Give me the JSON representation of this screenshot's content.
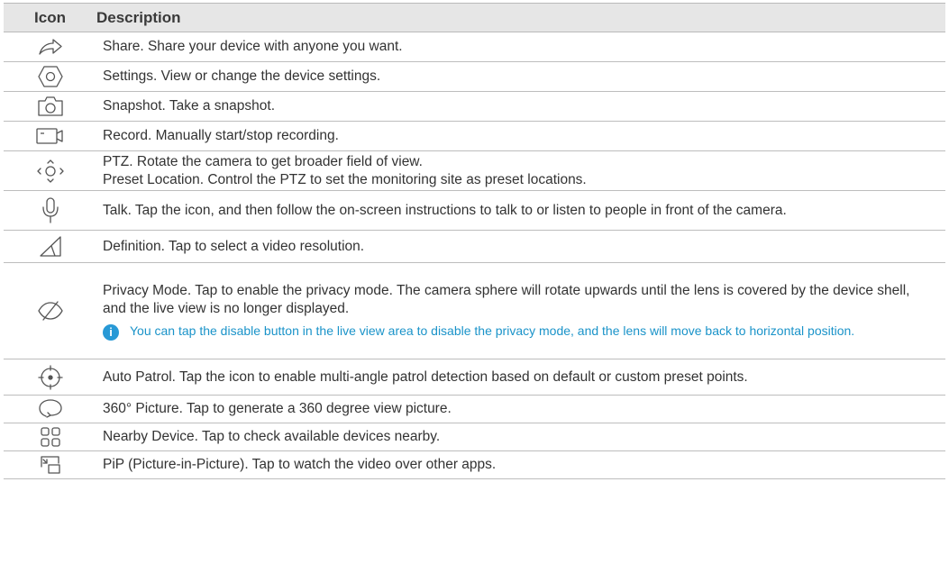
{
  "table": {
    "headers": {
      "icon": "Icon",
      "description": "Description"
    },
    "rows": [
      {
        "icon": "share-icon",
        "text": "Share. Share your device with anyone you want."
      },
      {
        "icon": "settings-icon",
        "text": "Settings. View or change the device settings."
      },
      {
        "icon": "camera-icon",
        "text": "Snapshot. Take a snapshot."
      },
      {
        "icon": "record-icon",
        "text": "Record. Manually start/stop recording."
      },
      {
        "icon": "ptz-icon",
        "text": "PTZ. Rotate the camera to get broader field of view.",
        "text2": "Preset Location. Control the PTZ to set the monitoring site as preset locations."
      },
      {
        "icon": "microphone-icon",
        "text": "Talk. Tap the icon, and then follow the on-screen instructions to talk to or listen to people in front of the camera."
      },
      {
        "icon": "definition-icon",
        "text": "Definition. Tap to select a video resolution."
      },
      {
        "icon": "privacy-icon",
        "text": "Privacy Mode. Tap to enable the privacy mode. The camera sphere will rotate upwards until the lens is covered by the device shell, and the live view is no longer displayed.",
        "note": "You can tap the disable button in the live view area to disable the privacy mode, and the lens will move back to horizontal position."
      },
      {
        "icon": "auto-patrol-icon",
        "text": "Auto Patrol. Tap the icon to enable multi-angle patrol detection based on default or custom preset points."
      },
      {
        "icon": "360-picture-icon",
        "text": "360° Picture. Tap to generate a 360 degree view picture."
      },
      {
        "icon": "nearby-device-icon",
        "text": "Nearby Device. Tap to check available devices nearby."
      },
      {
        "icon": "pip-icon",
        "text": "PiP (Picture-in-Picture). Tap to watch the video over other apps."
      }
    ],
    "colors": {
      "header_bg": "#e6e6e6",
      "note_text": "#1a93c9",
      "info_badge": "#2899d6",
      "icon_stroke": "#555555"
    }
  }
}
